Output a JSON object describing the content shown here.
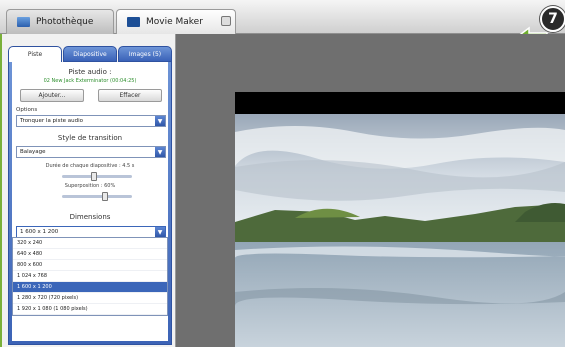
{
  "tabs": [
    {
      "label": "Photothèque",
      "icon": "photo-library-icon"
    },
    {
      "label": "Movie Maker",
      "icon": "film-icon"
    }
  ],
  "step_badge": "7",
  "panel": {
    "tabs": [
      "Piste",
      "Diapositive",
      "Images (5)"
    ],
    "audio_title": "Piste audio :",
    "audio_track": "02 New Jack Exterminator (00:04:25)",
    "add_button": "Ajouter...",
    "delete_button": "Effacer",
    "options_label": "Options",
    "options_value": "Tronquer la piste audio",
    "transition_title": "Style de transition",
    "transition_value": "Balayage",
    "duration_label": "Durée de chaque diapositive : 4.5 s",
    "overlap_label": "Superposition : 60%",
    "dimensions_title": "Dimensions",
    "dimensions_value": "1 600 x 1 200",
    "dimension_options": [
      "320 x 240",
      "640 x 480",
      "800 x 600",
      "1 024 x 768",
      "1 600 x 1 200",
      "1 280 x 720 (720 pixels)",
      "1 920 x 1 080 (1 080 pixels)"
    ],
    "selected_option_index": 4,
    "duration_slider_level": 0.45,
    "overlap_slider_level": 0.6
  },
  "colors": {
    "accent": "#3b66b9",
    "track_green": "#2e8f2e",
    "badge_green": "#6fae2e"
  }
}
